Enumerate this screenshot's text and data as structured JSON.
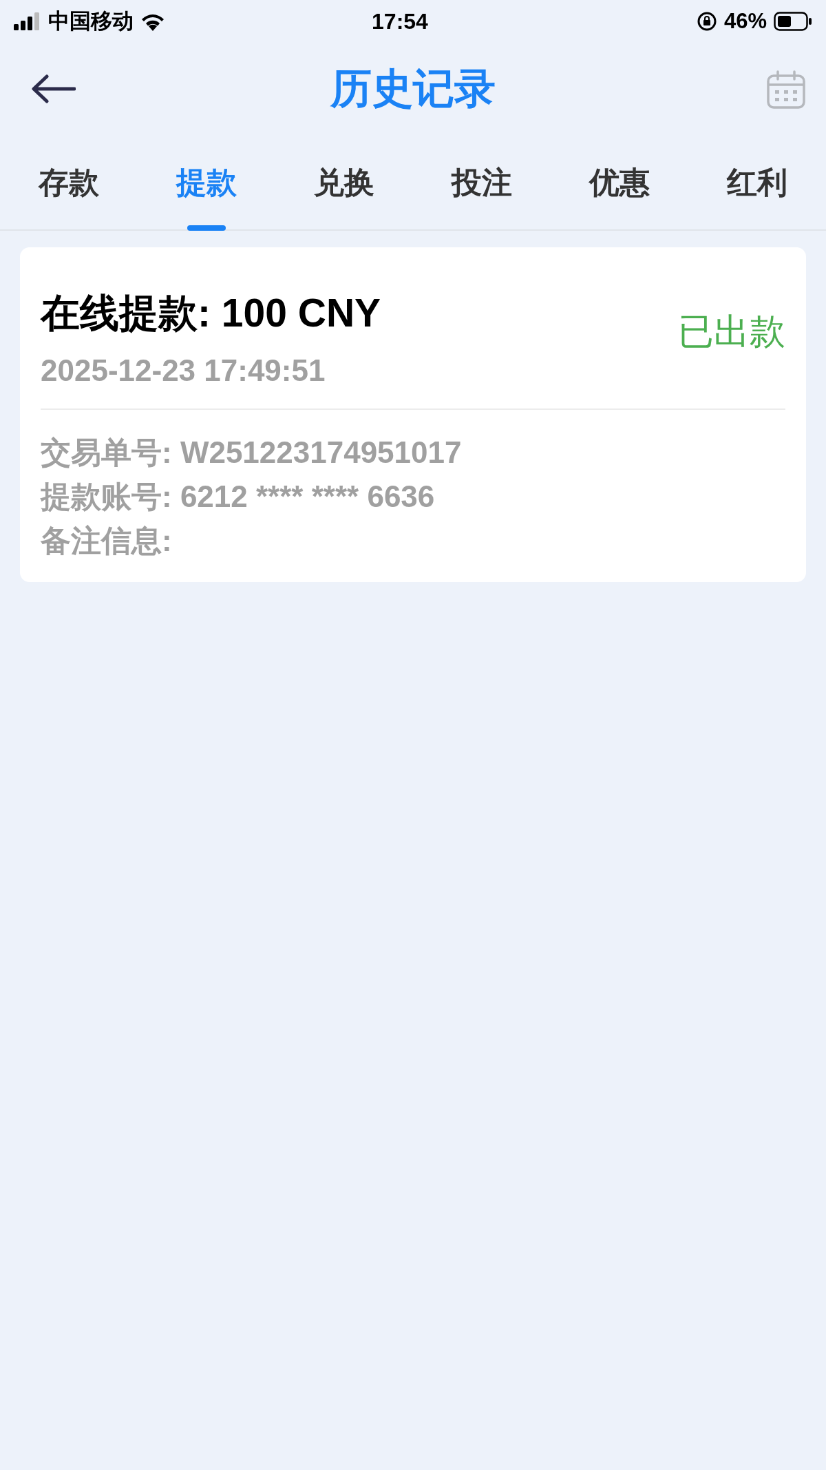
{
  "status_bar": {
    "carrier": "中国移动",
    "time": "17:54",
    "battery": "46%"
  },
  "header": {
    "title": "历史记录"
  },
  "tabs": [
    {
      "label": "存款",
      "selected": false
    },
    {
      "label": "提款",
      "selected": true
    },
    {
      "label": "兑换",
      "selected": false
    },
    {
      "label": "投注",
      "selected": false
    },
    {
      "label": "优惠",
      "selected": false
    },
    {
      "label": "红利",
      "selected": false
    }
  ],
  "records": [
    {
      "title": "在线提款: 100 CNY",
      "status": "已出款",
      "time": "2025-12-23 17:49:51",
      "details": [
        "交易单号: W251223174951017",
        "提款账号: 6212 **** **** 6636",
        "备注信息:"
      ]
    }
  ]
}
